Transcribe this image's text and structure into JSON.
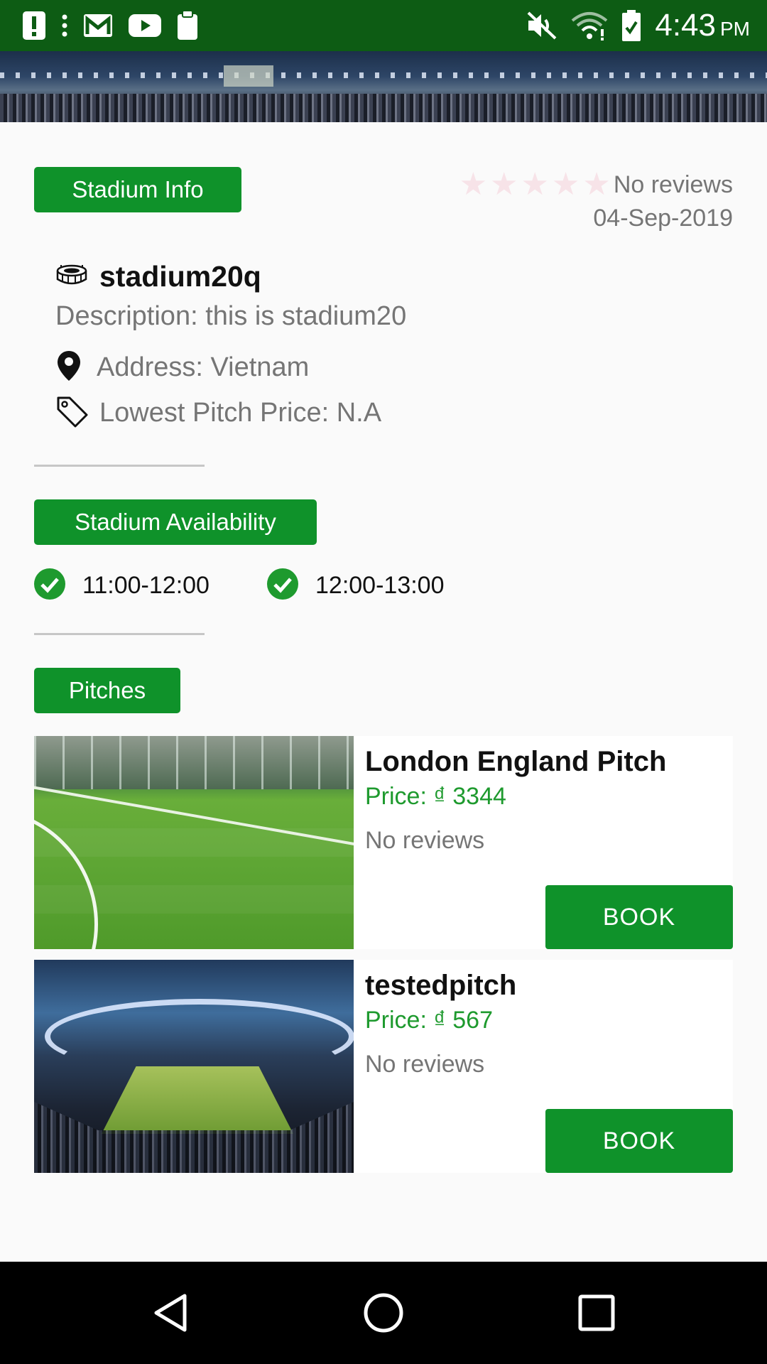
{
  "status_bar": {
    "time": "4:43",
    "ampm": "PM",
    "left_icons": [
      "alert-icon",
      "more-vert-icon",
      "gmail-icon",
      "youtube-icon",
      "clipboard-icon"
    ],
    "right_icons": [
      "mute-icon",
      "wifi-icon",
      "battery-icon"
    ]
  },
  "stadium": {
    "info_header": "Stadium Info",
    "rating_text": "No reviews",
    "rating_stars": 0,
    "rating_max": 5,
    "date": "04-Sep-2019",
    "name": "stadium20q",
    "description": "Description: this is stadium20",
    "address": "Address: Vietnam",
    "lowest_price": "Lowest Pitch Price: N.A"
  },
  "availability": {
    "header": "Stadium Availability",
    "slots": [
      "11:00-12:00",
      "12:00-13:00"
    ]
  },
  "pitches": {
    "header": "Pitches",
    "items": [
      {
        "name": "London England Pitch",
        "price": "Price: ₫ 3344",
        "reviews": "No reviews",
        "book_label": "BOOK"
      },
      {
        "name": "testedpitch",
        "price": "Price: ₫ 567",
        "reviews": "No reviews",
        "book_label": "BOOK"
      }
    ]
  },
  "nav": {
    "buttons": [
      "back-icon",
      "home-icon",
      "recents-icon"
    ]
  },
  "colors": {
    "status_bar": "#0d5c14",
    "accent_green": "#0f922a",
    "price_green": "#1e9a2e",
    "star_empty": "#f7e3e8"
  }
}
